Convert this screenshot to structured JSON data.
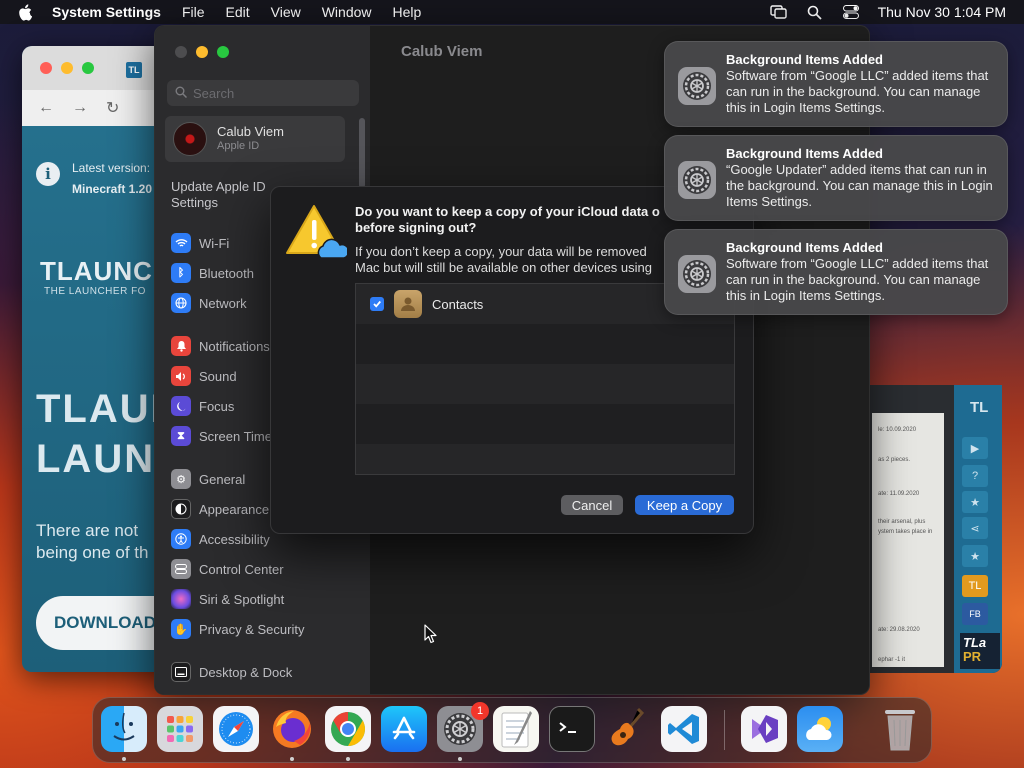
{
  "menubar": {
    "app_name": "System Settings",
    "menus": [
      "File",
      "Edit",
      "View",
      "Window",
      "Help"
    ],
    "clock": "Thu Nov 30  1:04 PM"
  },
  "browser": {
    "latest_line1": "Latest version:",
    "latest_line2": "Minecraft 1.20",
    "brand": "TLAUNC",
    "brand_sub": "THE LAUNCHER FO",
    "big_line1": "TLAUN",
    "big_line2": "LAUNC",
    "desc_line1": "There are not",
    "desc_line2": "being one of th",
    "download": "DOWNLOAD"
  },
  "launcher": {
    "logo": "TL",
    "doc_lines": [
      "le: 10.09.2020",
      "as 2 pieces.",
      "ate: 11.09.2020",
      "their arsenal, plus",
      "ystem takes place in",
      "ate: 29.08.2020",
      "ephar -1  it"
    ],
    "box_line1": "TLa",
    "box_line2": "PR"
  },
  "settings": {
    "window_title": "Calub Viem",
    "search_placeholder": "Search",
    "apple_id_name": "Calub Viem",
    "apple_id_sub": "Apple ID",
    "update_line1": "Update Apple ID",
    "update_line2": "Settings",
    "sidebar_items": [
      {
        "label": "Wi-Fi",
        "color": "#2e7cf6",
        "icon": "wifi-icon"
      },
      {
        "label": "Bluetooth",
        "color": "#2e7cf6",
        "icon": "bluetooth-icon"
      },
      {
        "label": "Network",
        "color": "#2e7cf6",
        "icon": "globe-icon"
      },
      {
        "label": "Notifications",
        "color": "#e8453c",
        "icon": "bell-icon"
      },
      {
        "label": "Sound",
        "color": "#e8453c",
        "icon": "speaker-icon"
      },
      {
        "label": "Focus",
        "color": "#5b4bd6",
        "icon": "moon-icon"
      },
      {
        "label": "Screen Time",
        "color": "#5b4bd6",
        "icon": "hourglass-icon"
      },
      {
        "label": "General",
        "color": "#8e8e93",
        "icon": "gear-icon"
      },
      {
        "label": "Appearance",
        "color": "#1c1c1e",
        "icon": "appearance-icon"
      },
      {
        "label": "Accessibility",
        "color": "#2e7cf6",
        "icon": "accessibility-icon"
      },
      {
        "label": "Control Center",
        "color": "#8e8e93",
        "icon": "control-center-icon"
      },
      {
        "label": "Siri & Spotlight",
        "color": "#b24ad6",
        "icon": "siri-icon"
      },
      {
        "label": "Privacy & Security",
        "color": "#2e7cf6",
        "icon": "hand-icon"
      },
      {
        "label": "Desktop & Dock",
        "color": "#1c1c1e",
        "icon": "dock-icon"
      }
    ]
  },
  "dialog": {
    "question": "Do you want to keep a copy of your iCloud data o\nbefore signing out?",
    "message": "If you don’t keep a copy, your data will be removed\nMac but will still be available on other devices using",
    "list_items": [
      {
        "label": "Contacts",
        "checked": true
      }
    ],
    "cancel": "Cancel",
    "keep": "Keep a Copy"
  },
  "notifications": [
    {
      "title": "Background Items Added",
      "body": "Software from “Google LLC” added items that can run in the background. You can manage this in Login Items Settings."
    },
    {
      "title": "Background Items Added",
      "body": "“Google Updater” added items that can run in the background. You can manage this in Login Items Settings."
    },
    {
      "title": "Background Items Added",
      "body": "Software from “Google LLC” added items that can run in the background. You can manage this in Login Items Settings."
    }
  ],
  "dock": {
    "apps": [
      "Finder",
      "Launchpad",
      "Safari",
      "Firefox",
      "Chrome",
      "App Store",
      "System Settings",
      "TextEdit",
      "Terminal",
      "GarageBand",
      "Visual Studio Code",
      "Visual Studio",
      "Weather",
      "Trash"
    ],
    "settings_badge": "1"
  }
}
